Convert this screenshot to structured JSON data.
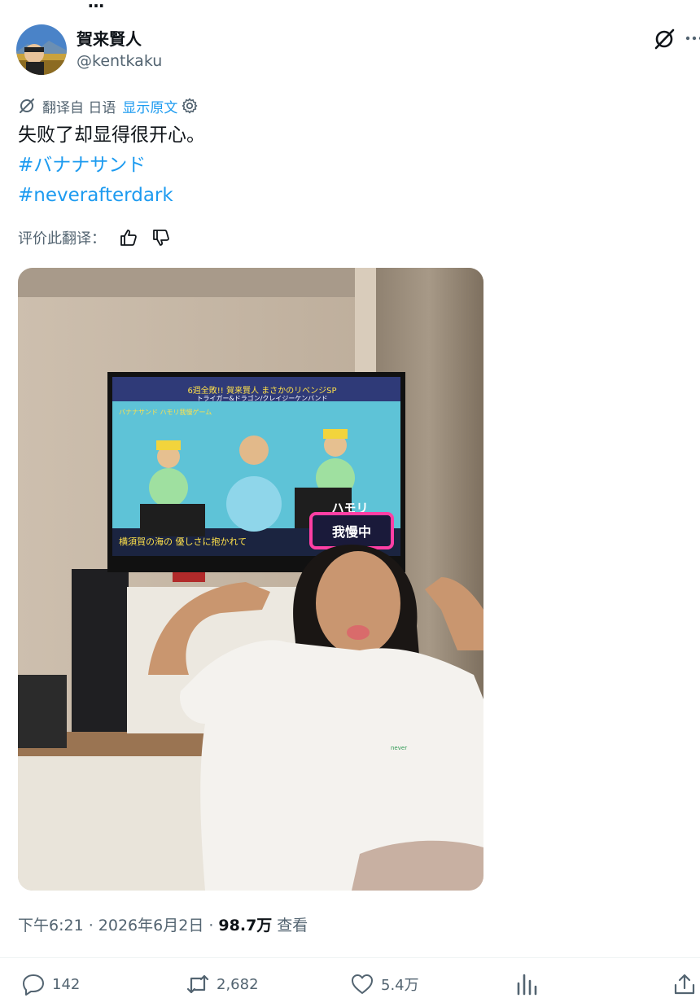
{
  "author": {
    "display_name": "賀来賢人",
    "handle": "@kentkaku"
  },
  "translation": {
    "translated_from": "翻译自 日语",
    "show_original": "显示原文",
    "rate_prompt": "评价此翻译："
  },
  "tweet": {
    "text": "失败了却显得很开心。",
    "hashtags": [
      "#バナナサンド",
      "#neverafterdark"
    ]
  },
  "media": {
    "tv_banner_top": "6週全敗!! 賀来賢人 まさかのリベンジSP",
    "tv_banner_sub": "トライガー&ドラゴン/クレイジーケンバンド",
    "tv_show_logo": "バナナサンド ハモリ我慢ゲーム",
    "tv_caption": "ハモリ",
    "tv_badge": "我慢中",
    "tv_subtitle": "横須賀の海の 優しさに抱かれて"
  },
  "meta": {
    "time": "下午6:21 · 2026年6月2日 ·",
    "views_count": "98.7万",
    "views_label": "查看"
  },
  "actions": {
    "reply_count": "142",
    "retweet_count": "2,682",
    "like_count": "5.4万"
  },
  "icons": {
    "grok": "grok-icon",
    "more": "more-icon",
    "translate": "translate-icon",
    "settings": "gear-icon",
    "thumbs_up": "thumbs-up-icon",
    "thumbs_down": "thumbs-down-icon",
    "reply": "reply-icon",
    "retweet": "retweet-icon",
    "like": "heart-icon",
    "views": "views-icon",
    "share": "share-icon"
  },
  "colors": {
    "link": "#1d9bf0",
    "secondary_text": "#536471",
    "primary_text": "#0f1419"
  }
}
